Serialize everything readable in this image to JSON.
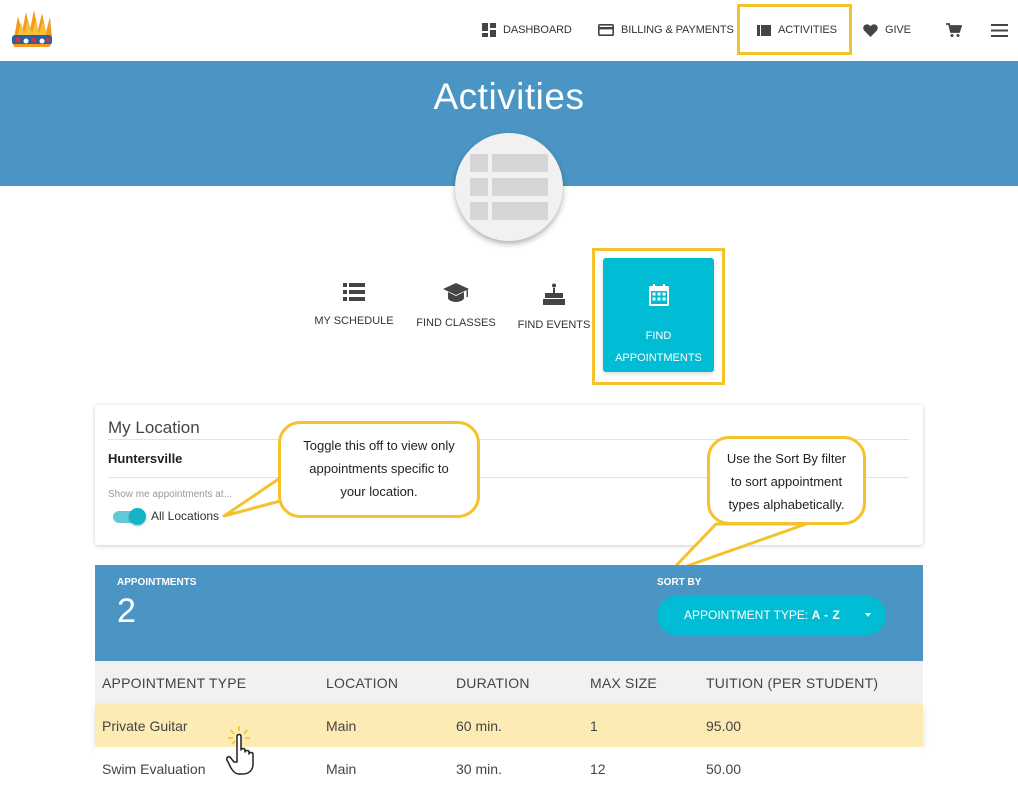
{
  "nav": {
    "items": [
      {
        "label": "DASHBOARD",
        "icon": "dashboard-icon"
      },
      {
        "label": "BILLING & PAYMENTS",
        "icon": "credit-card-icon"
      },
      {
        "label": "ACTIVITIES",
        "icon": "list-icon"
      },
      {
        "label": "GIVE",
        "icon": "heart-icon"
      }
    ],
    "cart_icon": "cart-icon",
    "menu_icon": "hamburger-icon",
    "highlight_color": "#f5c22b"
  },
  "hero": {
    "title": "Activities",
    "background": "#4a95c4",
    "icon": "table-icon"
  },
  "tabs": [
    {
      "label": "MY SCHEDULE",
      "icon": "list-icon"
    },
    {
      "label": "FIND CLASSES",
      "icon": "graduation-cap-icon"
    },
    {
      "label": "FIND EVENTS",
      "icon": "birthday-cake-icon"
    },
    {
      "label_line1": "FIND",
      "label_line2": "APPOINTMENTS",
      "icon": "calendar-icon",
      "active": true
    }
  ],
  "location": {
    "title": "My Location",
    "name": "Huntersville",
    "show_me": "Show me appointments at...",
    "toggle_label": "All Locations",
    "toggle_on": true
  },
  "callouts": {
    "toggle": [
      "Toggle this off to view only",
      "appointments specific to",
      "your location."
    ],
    "sort": [
      "Use the Sort By filter",
      "to sort appointment",
      "types alphabetically."
    ]
  },
  "appointments": {
    "label": "APPOINTMENTS",
    "count": "2",
    "sort_label": "SORT BY",
    "sort_prefix": "APPOINTMENT TYPE:",
    "sort_value": "A - Z"
  },
  "table": {
    "headers": [
      "APPOINTMENT TYPE",
      "LOCATION",
      "DURATION",
      "MAX SIZE",
      "TUITION (PER STUDENT)"
    ],
    "rows": [
      {
        "type": "Private Guitar",
        "location": "Main",
        "duration": "60 min.",
        "max_size": "1",
        "tuition": "95.00",
        "highlighted": true
      },
      {
        "type": "Swim Evaluation",
        "location": "Main",
        "duration": "30 min.",
        "max_size": "12",
        "tuition": "50.00",
        "highlighted": false
      }
    ]
  },
  "colors": {
    "accent": "#00bcd4",
    "primary": "#4a95c4",
    "highlight": "#f5c22b",
    "row_highlight": "#fcebb4"
  }
}
